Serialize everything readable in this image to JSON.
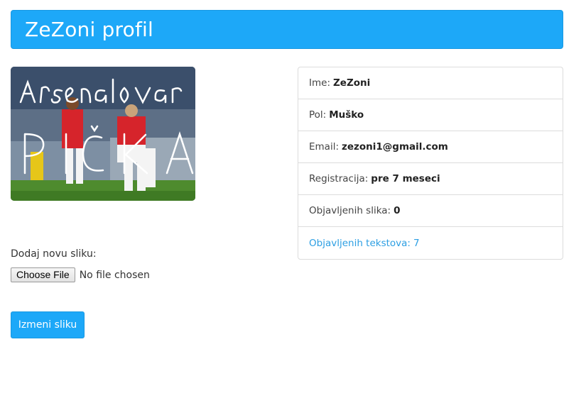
{
  "header": {
    "title": "ZeZoni profil"
  },
  "profile": {
    "image_alt": "Arsenal players photo with handwritten overlay",
    "image_overlay_text": [
      "ArsenalLovar",
      "PIČKA"
    ]
  },
  "upload": {
    "label": "Dodaj novu sliku:",
    "choose_label": "Choose File",
    "status": "No file chosen"
  },
  "submit": {
    "label": "Izmeni sliku"
  },
  "info": [
    {
      "key": "Ime:",
      "value": "ZeZoni"
    },
    {
      "key": "Pol:",
      "value": "Muško"
    },
    {
      "key": "Email:",
      "value": "zezoni1@gmail.com"
    },
    {
      "key": "Registracija:",
      "value": "pre 7 meseci"
    },
    {
      "key": "Objavljenih slika:",
      "value": "0"
    },
    {
      "key": "Objavljenih tekstova:",
      "value": "7"
    }
  ],
  "colors": {
    "accent": "#1da8f8",
    "link": "#2d9fe3",
    "border": "#dcdcdc"
  }
}
